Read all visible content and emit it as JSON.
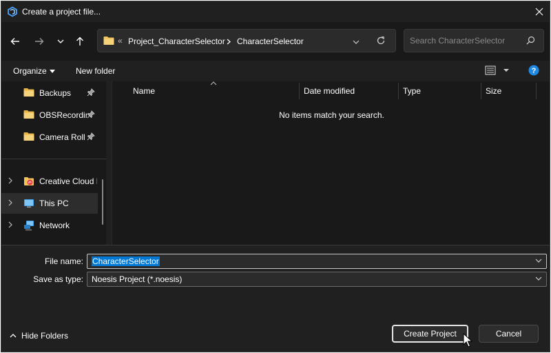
{
  "titlebar": {
    "title": "Create a project file..."
  },
  "address": {
    "overflow": "«",
    "crumbs": [
      "Project_CharacterSelector",
      "CharacterSelector"
    ]
  },
  "search": {
    "placeholder": "Search CharacterSelector"
  },
  "commands": {
    "organize": "Organize",
    "new_folder": "New folder"
  },
  "nav_pane": {
    "quick_access": [
      {
        "label": "Backups"
      },
      {
        "label": "OBSRecordings"
      },
      {
        "label": "Camera Roll"
      }
    ],
    "locations": [
      {
        "label": "Creative Cloud Files"
      },
      {
        "label": "This PC"
      },
      {
        "label": "Network"
      }
    ]
  },
  "columns": [
    "Name",
    "Date modified",
    "Type",
    "Size"
  ],
  "empty_message": "No items match your search.",
  "form": {
    "file_name_label": "File name:",
    "file_name_value": "CharacterSelector",
    "type_label": "Save as type:",
    "type_value": "Noesis Project (*.noesis)"
  },
  "footer": {
    "hide_folders": "Hide Folders",
    "create_button": "Create Project",
    "cancel_button": "Cancel"
  },
  "colors": {
    "accent": "#0078d4",
    "folder": "#f2c55c",
    "background": "#202020"
  }
}
